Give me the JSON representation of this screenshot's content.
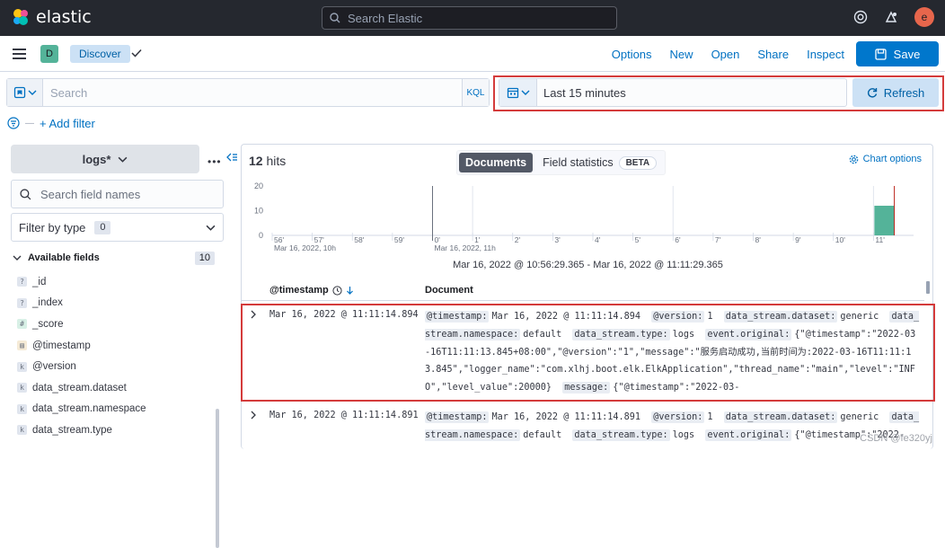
{
  "header": {
    "brand": "elastic",
    "search_placeholder": "Search Elastic",
    "avatar_letter": "e"
  },
  "appbar": {
    "space_letter": "D",
    "breadcrumb": "Discover",
    "menu": [
      "Options",
      "New",
      "Open",
      "Share",
      "Inspect"
    ],
    "save_label": "Save"
  },
  "query": {
    "placeholder": "Search",
    "language": "KQL",
    "time_range": "Last 15 minutes",
    "refresh_label": "Refresh",
    "add_filter": "+ Add filter"
  },
  "sidebar": {
    "index_pattern": "logs*",
    "field_search_placeholder": "Search field names",
    "filter_by_type": "Filter by type",
    "filter_count": "0",
    "available_label": "Available fields",
    "available_count": "10",
    "fields": [
      {
        "icon": "?",
        "name": "_id"
      },
      {
        "icon": "?",
        "name": "_index"
      },
      {
        "icon": "#",
        "name": "_score"
      },
      {
        "icon": "cal",
        "name": "@timestamp"
      },
      {
        "icon": "k",
        "name": "@version"
      },
      {
        "icon": "k",
        "name": "data_stream.dataset"
      },
      {
        "icon": "k",
        "name": "data_stream.namespace"
      },
      {
        "icon": "k",
        "name": "data_stream.type"
      }
    ]
  },
  "main": {
    "hits_count": "12",
    "hits_label": "hits",
    "tab_documents": "Documents",
    "tab_field_stats": "Field statistics",
    "beta": "BETA",
    "chart_options": "Chart options",
    "time_range_text": "Mar 16, 2022 @ 10:56:29.365 - Mar 16, 2022 @ 11:11:29.365",
    "col_timestamp": "@timestamp",
    "col_document": "Document",
    "rows": [
      {
        "timestamp": "Mar 16, 2022 @ 11:11:14.894",
        "fields": [
          {
            "k": "@timestamp:",
            "v": "Mar 16, 2022 @ 11:11:14.894"
          },
          {
            "k": "@version:",
            "v": "1"
          },
          {
            "k": "data_stream.dataset:",
            "v": "generic"
          },
          {
            "k": "data_stream.namespace:",
            "v": "default"
          },
          {
            "k": "data_stream.type:",
            "v": "logs"
          },
          {
            "k": "event.original:",
            "v": "{\"@timestamp\":\"2022-03-16T11:11:13.845+08:00\",\"@version\":\"1\",\"message\":\"服务启动成功,当前时间为:2022-03-16T11:11:13.845\",\"logger_name\":\"com.xlhj.boot.elk.ElkApplication\",\"thread_name\":\"main\",\"level\":\"INFO\",\"level_value\":20000}"
          },
          {
            "k": "message:",
            "v": "{\"@timestamp\":\"2022-03-"
          }
        ]
      },
      {
        "timestamp": "Mar 16, 2022 @ 11:11:14.891",
        "fields": [
          {
            "k": "@timestamp:",
            "v": "Mar 16, 2022 @ 11:11:14.891"
          },
          {
            "k": "@version:",
            "v": "1"
          },
          {
            "k": "data_stream.dataset:",
            "v": "generic"
          },
          {
            "k": "data_stream.namespace:",
            "v": "default"
          },
          {
            "k": "data_stream.type:",
            "v": "logs"
          },
          {
            "k": "event.original:",
            "v": "{\"@timestamp\":\"2022-"
          }
        ]
      }
    ]
  },
  "chart_data": {
    "type": "bar",
    "ylim": [
      0,
      20
    ],
    "yticks": [
      "20",
      "10",
      "0"
    ],
    "categories": [
      "56'",
      "57'",
      "58'",
      "59'",
      "0'",
      "1'",
      "2'",
      "3'",
      "4'",
      "5'",
      "6'",
      "7'",
      "8'",
      "9'",
      "10'",
      "11'"
    ],
    "values": [
      0,
      0,
      0,
      0,
      0,
      0,
      0,
      0,
      0,
      0,
      0,
      0,
      0,
      0,
      0,
      12
    ],
    "major_labels": [
      "Mar 16, 2022, 10h",
      "Mar 16, 2022, 11h"
    ],
    "bar_color": "#54b399"
  },
  "watermark": "CSDN @fe320yj"
}
